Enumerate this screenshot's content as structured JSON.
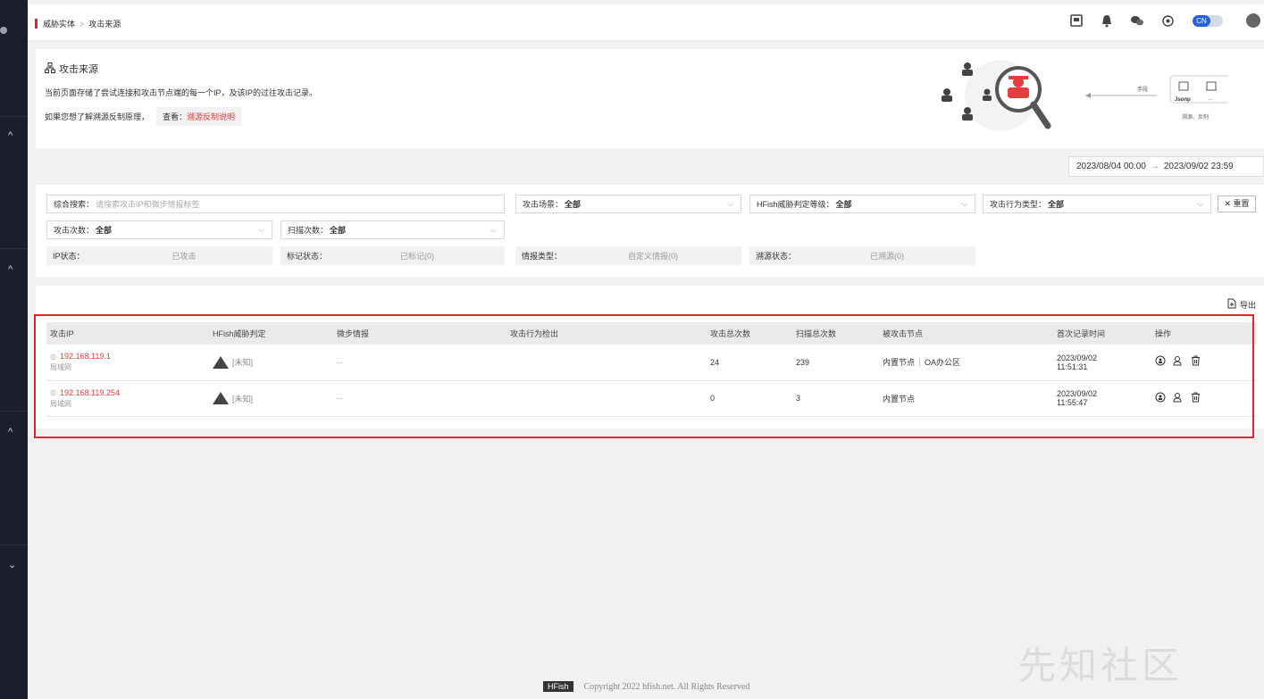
{
  "breadcrumb": {
    "parent": "威胁实体",
    "separator": ">",
    "current": "攻击来源"
  },
  "topbar": {
    "lang_toggle": "CN"
  },
  "info": {
    "title": "攻击来源",
    "line1": "当前页面存储了尝试连接和攻击节点端的每一个IP，及该IP的过往攻击记录。",
    "line2_prefix": "如果您想了解溯源反制原理，",
    "view_label": "查看：",
    "view_link": "溯源反制说明",
    "illus_label_means": "手段",
    "illus_label_jsonp": "Jsonp",
    "illus_label_dots": "···",
    "illus_label_trace": "溯源、反制"
  },
  "date_range": {
    "start": "2023/08/04 00:00",
    "arrow": "→",
    "end": "2023/09/02 23:59"
  },
  "filters": {
    "search_label": "综合搜索：",
    "search_placeholder": "请搜索攻击IP和微步情报标签",
    "scene_label": "攻击场景：",
    "scene_value": "全部",
    "level_label": "HFish威胁判定等级：",
    "level_value": "全部",
    "behavior_label": "攻击行为类型：",
    "behavior_value": "全部",
    "reset_label": "✕ 重置",
    "attack_count_label": "攻击次数：",
    "attack_count_value": "全部",
    "scan_count_label": "扫描次数：",
    "scan_count_value": "全部",
    "ip_state_label": "IP状态：",
    "ip_state_value": "已攻击",
    "mark_state_label": "标记状态：",
    "mark_state_value": "已标记(0)",
    "intel_type_label": "情报类型：",
    "intel_type_value": "自定义情报(0)",
    "trace_state_label": "溯源状态：",
    "trace_state_value": "已溯源(0)"
  },
  "table": {
    "export_label": "导出",
    "headers": [
      "攻击IP",
      "HFish威胁判定",
      "微步情报",
      "攻击行为检出",
      "攻击总次数",
      "扫描总次数",
      "被攻击节点",
      "首次记录时间",
      "操作"
    ],
    "rows": [
      {
        "ip": "192.168.119.1",
        "ip_sub": "局域网",
        "verdict": "[未知]",
        "intel": "--",
        "behavior": "",
        "attacks": "24",
        "scans": "239",
        "node": "内置节点",
        "node2": "OA办公区",
        "date": "2023/09/02",
        "time": "11:51:31"
      },
      {
        "ip": "192.168.119.254",
        "ip_sub": "局域网",
        "verdict": "[未知]",
        "intel": "--",
        "behavior": "",
        "attacks": "0",
        "scans": "3",
        "node": "内置节点",
        "node2": "",
        "date": "2023/09/02",
        "time": "11:55:47"
      }
    ]
  },
  "footer": {
    "logo": "HFish",
    "copyright": "Copyright 2022 hfish.net. All Rights Reserved"
  },
  "watermark": "先知社区",
  "colors": {
    "accent_red": "#e43d3d",
    "sidebar_bg": "#1b1f2c",
    "lang_blue": "#2763d6"
  }
}
